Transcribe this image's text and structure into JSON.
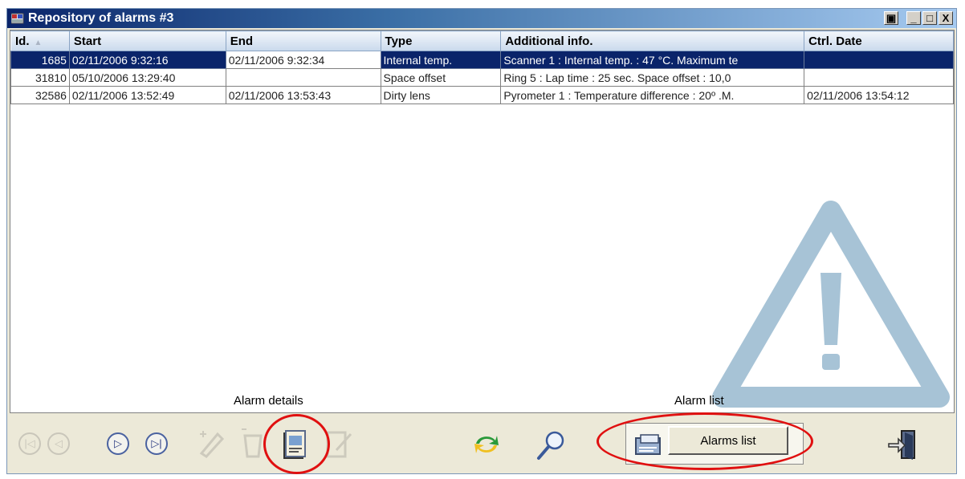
{
  "window": {
    "title": "Repository of alarms #3",
    "controls": {
      "restore": "▣",
      "minimize": "_",
      "maximize": "□",
      "close": "X"
    }
  },
  "table": {
    "columns": [
      "Id.",
      "Start",
      "End",
      "Type",
      "Additional info.",
      "Ctrl. Date"
    ],
    "sort_indicator": "▲",
    "rows": [
      {
        "id": "1685",
        "start": "02/11/2006 9:32:16",
        "end": "02/11/2006 9:32:34",
        "type": "Internal temp.",
        "info": "Scanner 1 : Internal temp. : 47 °C. Maximum te",
        "ctrl": "",
        "selected": true
      },
      {
        "id": "31810",
        "start": "05/10/2006 13:29:40",
        "end": "",
        "type": "Space offset",
        "info": "Ring 5 : Lap time : 25 sec. Space offset : 10,0",
        "ctrl": "",
        "selected": false
      },
      {
        "id": "32586",
        "start": "02/11/2006 13:52:49",
        "end": "02/11/2006 13:53:43",
        "type": "Dirty lens",
        "info": "Pyrometer 1 : Temperature difference : 20º .M.",
        "ctrl": "02/11/2006 13:54:12",
        "selected": false
      }
    ]
  },
  "captions": {
    "alarm_details": "Alarm details",
    "alarm_list": "Alarm list"
  },
  "toolbar": {
    "alarms_list_button": "Alarms list",
    "nav": {
      "first": "|◁",
      "prev": "◁",
      "next": "▷",
      "last": "▷|"
    },
    "icons": [
      "first-icon",
      "previous-icon",
      "next-icon",
      "last-icon",
      "add-icon",
      "delete-icon",
      "alarm-details-icon",
      "edit-icon",
      "refresh-icon",
      "search-icon",
      "alarms-list-icon",
      "exit-icon"
    ]
  },
  "colors": {
    "selection": "#0a246a",
    "highlight_ellipse": "#e01010",
    "warning_watermark": "#a7c3d6"
  }
}
